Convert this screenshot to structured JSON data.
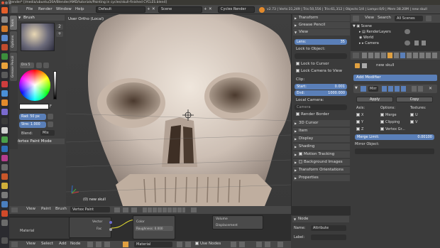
{
  "window": {
    "title": "Blender* [/media/ubuntu/20A/Blender/AMD/tutorials/Painting in cycles/skull-finished CYCLES.blend]"
  },
  "topmenu": {
    "menus": [
      "File",
      "Render",
      "Window",
      "Help"
    ],
    "layout": "Default",
    "scene": "Scene",
    "engine": "Cycles Render",
    "stats": "v2.73 | Verts:31,249 | Tris:50,556 | Tris:61,312 | Objects:1/4 | Lamps:0/0 | Mem:38.20M | new skull"
  },
  "toolshelf": {
    "tabs": [
      "Tools",
      "Options",
      "Grease Pencil"
    ],
    "brush_header": "Brush",
    "color_label": "F",
    "radius": "Rad: 50 px",
    "strength": "Stre: 1.000",
    "blend_label": "Blend:",
    "blend_value": "Mix",
    "mode_header": "Vertex Paint Mode",
    "plus": "+",
    "dup": "2"
  },
  "viewport": {
    "view_label": "User Ortho (Local)",
    "object_label": "(0) new skull"
  },
  "npanel": {
    "transform": "Transform",
    "grease_pencil": "Grease Pencil",
    "view": "View",
    "lens": "Lens:",
    "lens_value": "35",
    "lock_to_object": "Lock to Object:",
    "lock_to_cursor": "Lock to Cursor",
    "lock_camera": "Lock Camera to View",
    "clip": "Clip:",
    "clip_start": "Start:",
    "clip_start_value": "0.001",
    "clip_end": "End:",
    "clip_end_value": "1000.000",
    "local_camera": "Local Camera:",
    "camera_field": "Camera",
    "render_border": "Render Border",
    "cursor3d": "3D Cursor",
    "item": "Item",
    "display": "Display",
    "shading": "Shading",
    "motion_tracking": "Motion Tracking",
    "background_images": "Background Images",
    "transform_orientations": "Transform Orientations",
    "properties": "Properties"
  },
  "outliner": {
    "menus": [
      "View",
      "Search",
      "All Scenes"
    ],
    "items": [
      "Scene",
      "RenderLayers",
      "World",
      "Camera"
    ]
  },
  "props": {
    "object_name": "new skull",
    "add_modifier": "Add Modifier",
    "modifier_name": "Mirr",
    "apply": "Apply",
    "copy": "Copy",
    "axis": "Axis:",
    "options": "Options:",
    "textures": "Textures:",
    "x": "X",
    "y": "Y",
    "z": "Z",
    "merge": "Merge",
    "clipping": "Clipping",
    "vertex_groups": "Vertex Gr...",
    "u": "U",
    "v": "V",
    "merge_limit": "Merge Limit:",
    "merge_limit_value": "0.00100",
    "mirror_object": "Mirror Object:"
  },
  "nodeeditor": {
    "header_menus": [
      "View",
      "Paint",
      "Brush"
    ],
    "mode": "Vertex Paint",
    "material_node": "Material",
    "vector": "Vector",
    "fac": "Fac",
    "color": "Color",
    "roughness": "Roughness: 0.000",
    "volume": "Volume",
    "displacement": "Displacement",
    "bottom_menus": [
      "View",
      "Select",
      "Add",
      "Node"
    ],
    "material": "Material",
    "use_nodes": "Use Nodes"
  },
  "nodepanel": {
    "header": "Node",
    "name_label": "Name:",
    "name_value": "Attribute",
    "label_label": "Label:"
  }
}
